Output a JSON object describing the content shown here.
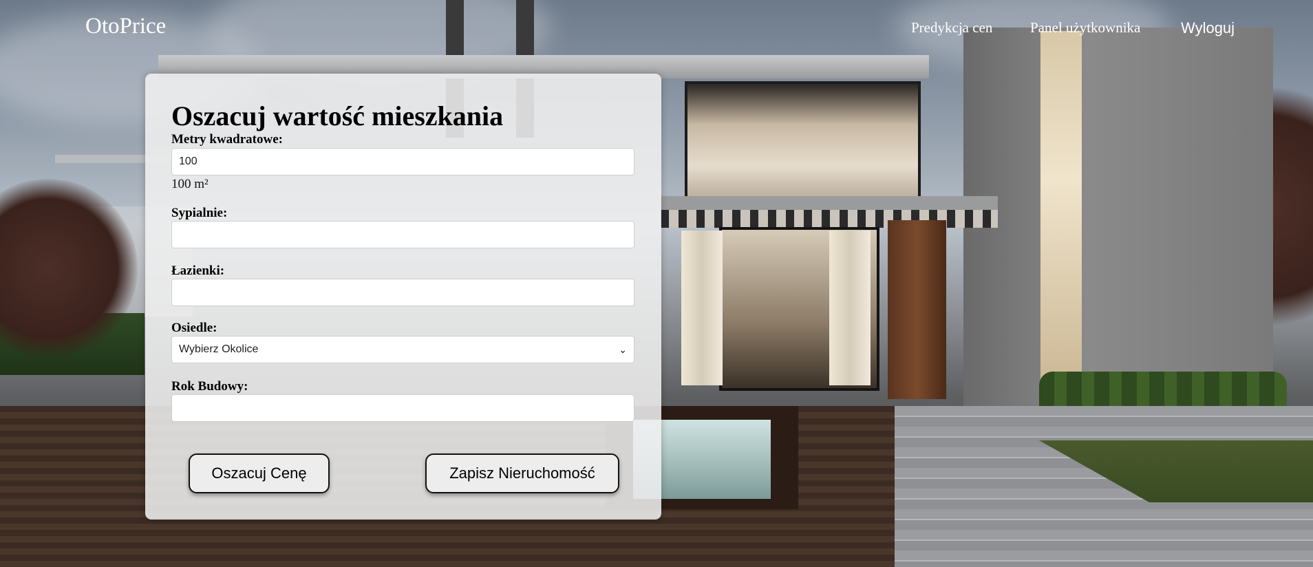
{
  "nav": {
    "brand": "OtoPrice",
    "links": [
      "Predykcja cen",
      "Panel użytkownika",
      "Wyloguj"
    ]
  },
  "form": {
    "title": "Oszacuj wartość mieszkania",
    "area_label": "Metry kwadratowe:",
    "area_value": "100",
    "area_hint": "100 m²",
    "bedrooms_label": "Sypialnie:",
    "bedrooms_value": "",
    "bathrooms_label": "Łazienki:",
    "bathrooms_value": "",
    "neighborhood_label": "Osiedle:",
    "neighborhood_selected": "Wybierz Okolice",
    "year_label": "Rok Budowy:",
    "year_value": "",
    "estimate_button": "Oszacuj Cenę",
    "save_button": "Zapisz Nieruchomość"
  },
  "colors": {
    "card_bg": "#f0f0f0",
    "nav_text": "#ffffff",
    "button_border": "#111111"
  }
}
